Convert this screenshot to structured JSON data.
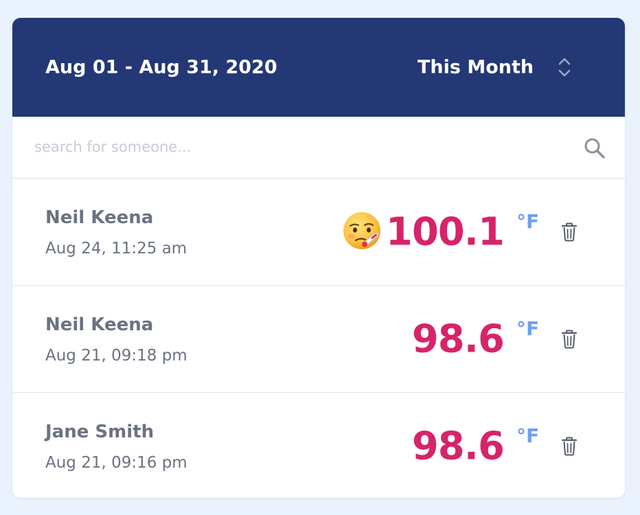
{
  "header": {
    "date_range": "Aug 01 - Aug 31, 2020",
    "period": "This Month",
    "period_icon": "chevron-up-down-icon",
    "background_color": "#243875"
  },
  "search": {
    "placeholder": "search for someone...",
    "value": "",
    "icon": "search-icon"
  },
  "readings": [
    {
      "name": "Neil Keena",
      "time": "Aug 24, 11:25 am",
      "temperature": "100.1",
      "unit": "°F",
      "feverish": true,
      "status_icon": "face-with-thermometer-icon"
    },
    {
      "name": "Neil Keena",
      "time": "Aug 21, 09:18 pm",
      "temperature": "98.6",
      "unit": "°F",
      "feverish": false
    },
    {
      "name": "Jane Smith",
      "time": "Aug 21, 09:16 pm",
      "temperature": "98.6",
      "unit": "°F",
      "feverish": false
    }
  ],
  "colors": {
    "temperature": "#d6246a",
    "unit": "#6e9ff0",
    "text": "#6b7280",
    "page_background": "#eaf3fd"
  },
  "row_action_icon": "trash-icon"
}
